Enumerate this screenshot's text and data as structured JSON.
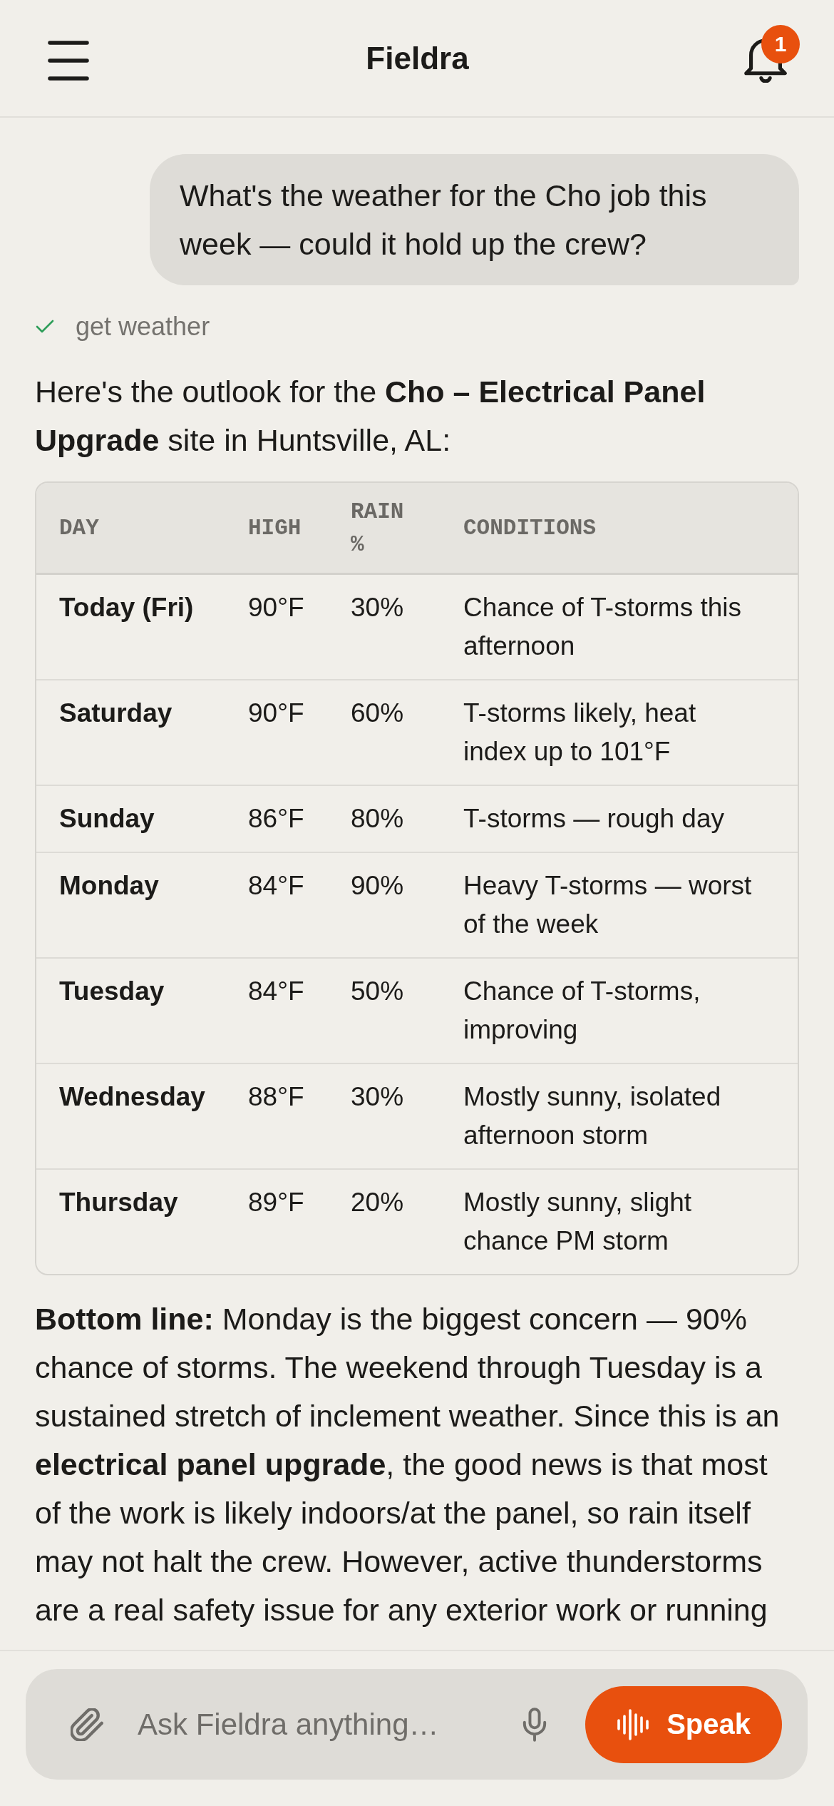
{
  "header": {
    "title": "Fieldra",
    "notification_count": "1"
  },
  "chat": {
    "user_message": "What's the weather for the Cho job this week — could it hold up the crew?",
    "tool_call": {
      "label": "get weather",
      "completed": true
    },
    "intro": "Here's the outlook for the **Cho – Electrical Panel Upgrade** site in Huntsville, AL:",
    "table": {
      "columns": [
        "DAY",
        "HIGH",
        "RAIN %",
        "CONDITIONS"
      ],
      "rows": [
        [
          "Today (Fri)",
          "90°F",
          "30%",
          "Chance of T-storms this afternoon"
        ],
        [
          "Saturday",
          "90°F",
          "60%",
          "T-storms likely, heat index up to 101°F"
        ],
        [
          "Sunday",
          "86°F",
          "80%",
          "T-storms — rough day"
        ],
        [
          "Monday",
          "84°F",
          "90%",
          "Heavy T-storms — worst of the week"
        ],
        [
          "Tuesday",
          "84°F",
          "50%",
          "Chance of T-storms, improving"
        ],
        [
          "Wednesday",
          "88°F",
          "30%",
          "Mostly sunny, isolated afternoon storm"
        ],
        [
          "Thursday",
          "89°F",
          "20%",
          "Mostly sunny, slight chance PM storm"
        ]
      ]
    },
    "summary": "**Bottom line:** Monday is the biggest concern — 90% chance of storms. The weekend through Tuesday is a sustained stretch of inclement weather. Since this is an **electrical panel upgrade**, the good news is that most of the work is likely indoors/at the panel, so rain itself may not halt the crew. However, active thunderstorms are a real safety issue for any exterior work or running"
  },
  "composer": {
    "placeholder": "Ask Fieldra anything…",
    "speak_button": "Speak"
  }
}
